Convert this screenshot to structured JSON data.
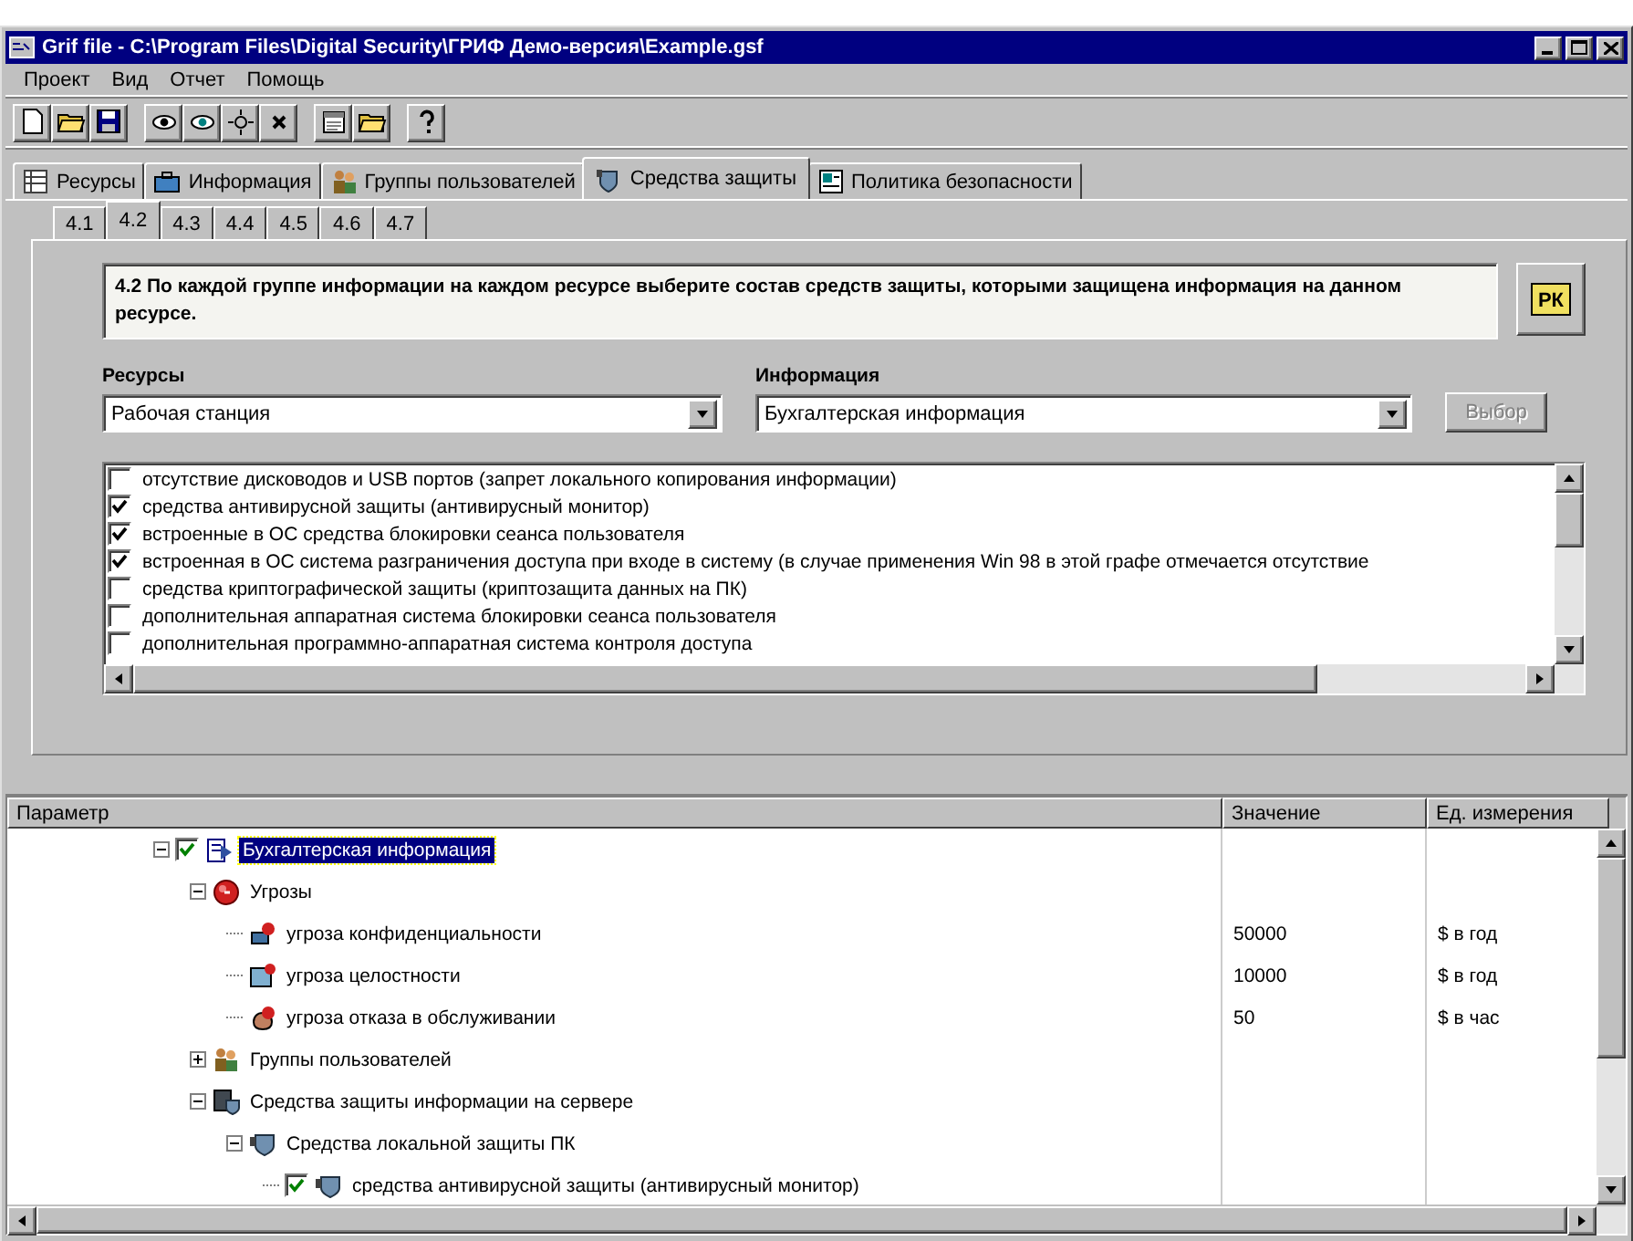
{
  "window": {
    "title": "Grif   file - C:\\Program Files\\Digital Security\\ГРИФ Демо-версия\\Example.gsf"
  },
  "menu": [
    "Проект",
    "Вид",
    "Отчет",
    "Помощь"
  ],
  "tabs": [
    {
      "label": "Ресурсы",
      "selected": false
    },
    {
      "label": "Информация",
      "selected": false
    },
    {
      "label": "Группы пользователей",
      "selected": false
    },
    {
      "label": "Средства защиты",
      "selected": true
    },
    {
      "label": "Политика безопасности",
      "selected": false
    }
  ],
  "subtabs": [
    {
      "label": "4.1",
      "selected": false
    },
    {
      "label": "4.2",
      "selected": true
    },
    {
      "label": "4.3",
      "selected": false
    },
    {
      "label": "4.4",
      "selected": false
    },
    {
      "label": "4.5",
      "selected": false
    },
    {
      "label": "4.6",
      "selected": false
    },
    {
      "label": "4.7",
      "selected": false
    }
  ],
  "instruction": "4.2 По каждой группе информации на каждом ресурсе выберите состав средств защиты, которыми защищена информация на данном ресурсе.",
  "report_button": {
    "label": "РК"
  },
  "resources": {
    "label": "Ресурсы",
    "value": "Рабочая станция"
  },
  "information": {
    "label": "Информация",
    "value": "Бухгалтерская информация"
  },
  "select_button": {
    "label": "Выбор",
    "disabled": true
  },
  "measures": [
    {
      "label": "отсутствие дисководов и USB портов (запрет локального копирования информации)",
      "checked": false
    },
    {
      "label": "средства антивирусной защиты (антивирусный монитор)",
      "checked": true
    },
    {
      "label": "встроенные в ОС средства блокировки сеанса пользователя",
      "checked": true
    },
    {
      "label": "встроенная в ОС система разграничения доступа при входе в систему (в случае применения Win 98 в этой графе отмечается отсутствие",
      "checked": true
    },
    {
      "label": "средства криптографической защиты (криптозащита данных на ПК)",
      "checked": false
    },
    {
      "label": "дополнительная аппаратная система блокировки сеанса пользователя",
      "checked": false
    },
    {
      "label": "дополнительная программно-аппаратная система контроля доступа",
      "checked": false
    }
  ],
  "tree": {
    "columns": [
      "Параметр",
      "Значение",
      "Ед. измерения"
    ],
    "nodes": [
      {
        "label": "Бухгалтерская информация",
        "kind": "info",
        "checked": true,
        "expanded": true,
        "selected": true,
        "children": [
          {
            "label": "Угрозы",
            "kind": "threats",
            "expanded": true,
            "selected": false,
            "children": [
              {
                "label": "угроза конфиденциальности",
                "kind": "threat-confidentiality",
                "value": "50000",
                "unit": "$ в год",
                "selected": false
              },
              {
                "label": "угроза целостности",
                "kind": "threat-integrity",
                "value": "10000",
                "unit": "$ в год",
                "selected": false
              },
              {
                "label": "угроза отказа в обслуживании",
                "kind": "threat-denial",
                "value": "50",
                "unit": "$ в час",
                "selected": false
              }
            ]
          },
          {
            "label": "Группы пользователей",
            "kind": "users",
            "expanded": false,
            "selected": false
          },
          {
            "label": "Средства защиты информации на сервере",
            "kind": "server",
            "expanded": true,
            "selected": false,
            "children": [
              {
                "label": "Средства локальной защиты ПК",
                "kind": "shield",
                "expanded": true,
                "selected": false,
                "children": [
                  {
                    "label": "средства антивирусной защиты (антивирусный монитор)",
                    "kind": "shield",
                    "checked": true,
                    "selected": false
                  }
                ]
              }
            ]
          }
        ]
      }
    ]
  }
}
